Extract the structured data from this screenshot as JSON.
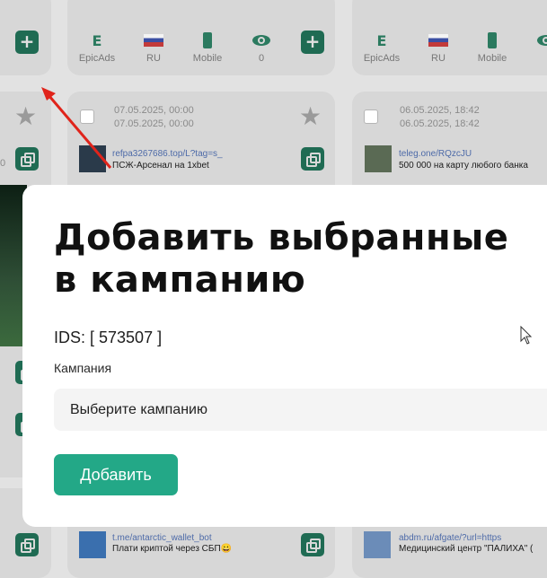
{
  "stats_row": {
    "items": [
      {
        "icon": "e-icon",
        "label": "EpicAds"
      },
      {
        "icon": "russia-flag-icon",
        "label": "RU"
      },
      {
        "icon": "mobile-icon",
        "label": "Mobile"
      },
      {
        "icon": "eye-icon",
        "label": "0"
      }
    ]
  },
  "cards": {
    "left": {
      "date_start": "07.05.2025, 00:00",
      "date_end": "07.05.2025, 00:00",
      "link": "refpa3267686.top/L?tag=s_",
      "title": "ПСЖ-Арсенал на 1xbet"
    },
    "right": {
      "date_start": "06.05.2025, 18:42",
      "date_end": "06.05.2025, 18:42",
      "link": "teleg.one/RQzcJU",
      "title": "500 000 на карту любого банка"
    },
    "bottom_left": {
      "link": "t.me/antarctic_wallet_bot",
      "title": "Плати криптой через СБП😀"
    },
    "bottom_right": {
      "link": "abdm.ru/afgate/?url=https",
      "title": "Медицинский центр \"ПАЛИХА\" ("
    }
  },
  "edge_text": "0",
  "modal": {
    "title": "Добавить выбранные в кампанию",
    "ids": "IDS: [ 573507 ]",
    "campaign_label": "Кампания",
    "campaign_placeholder": "Выберите кампанию",
    "add_button": "Добавить"
  },
  "colors": {
    "accent": "#23a887",
    "dark_button": "#1f6b53",
    "arrow": "#e0241b"
  }
}
